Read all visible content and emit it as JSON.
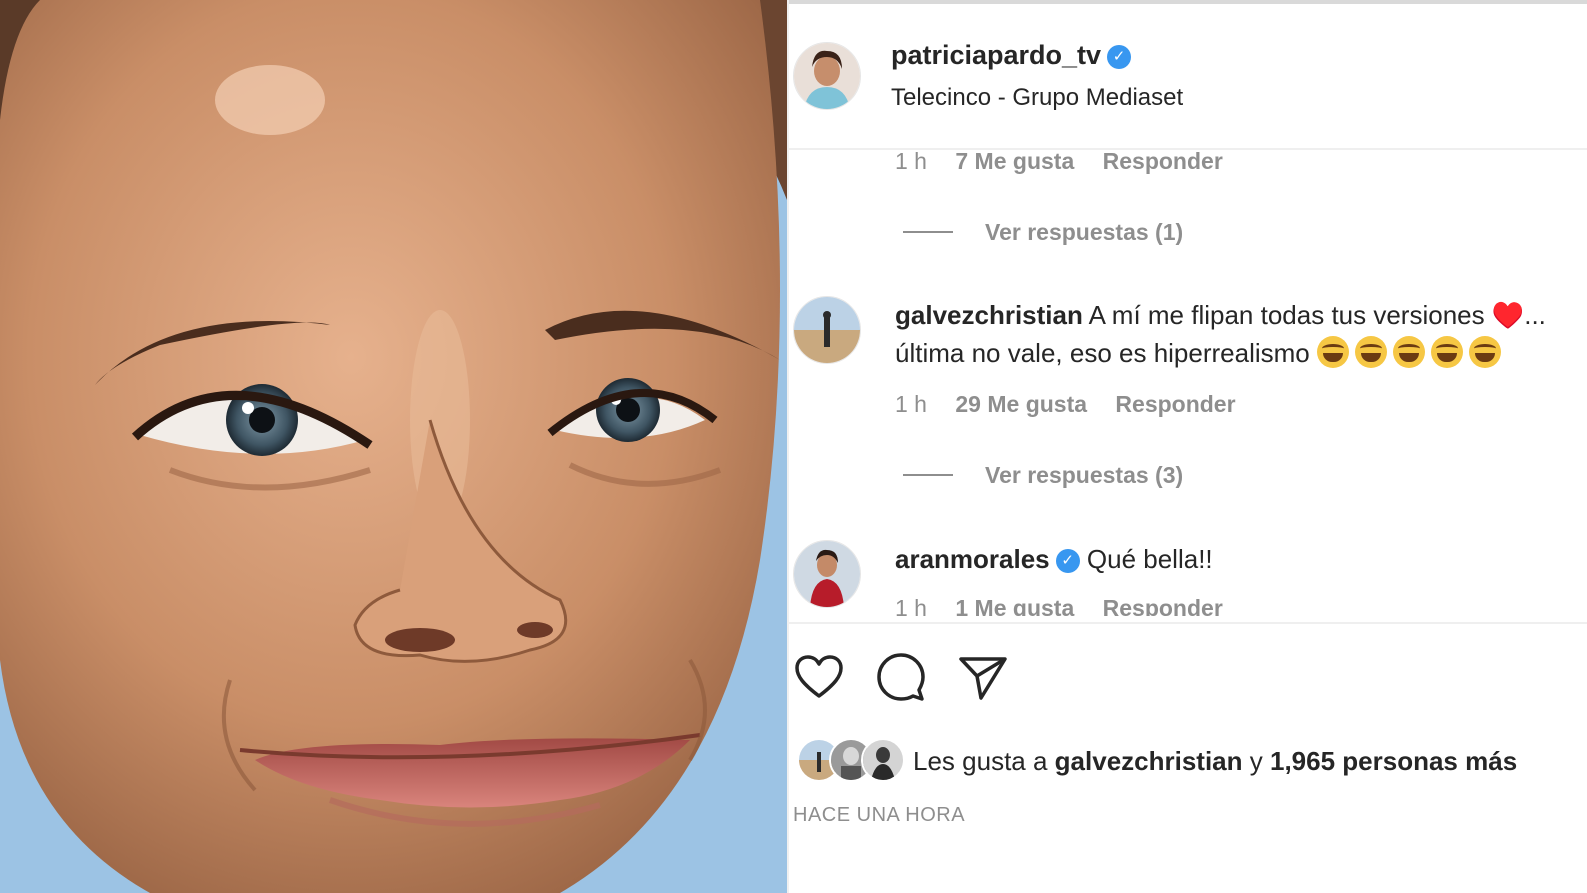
{
  "post": {
    "username": "patriciapardo_tv",
    "location": "Telecinco - Grupo Mediaset",
    "verified": true
  },
  "comments": [
    {
      "time": "1 h",
      "likes": "7 Me gusta",
      "reply": "Responder",
      "view_replies": "Ver respuestas (1)"
    },
    {
      "username": "galvezchristian",
      "text": "A mí me flipan todas tus versiones ♥️...",
      "text_line2": "última no vale, eso es hiperrealismo",
      "emoji_count": 5,
      "time": "1 h",
      "likes": "29 Me gusta",
      "reply": "Responder",
      "view_replies": "Ver respuestas (3)"
    },
    {
      "username": "aranmorales",
      "verified": true,
      "text": "Qué bella!!",
      "time": "1 h",
      "likes": "1 Me gusta",
      "reply": "Responder"
    }
  ],
  "likes": {
    "prefix": "Les gusta a",
    "user": "galvezchristian",
    "conj": "y",
    "others": "1,965 personas más"
  },
  "timestamp": "HACE UNA HORA",
  "colors": {
    "verified": "#3897f0",
    "text": "#262626",
    "muted": "#8e8e8e"
  },
  "icons": [
    "heart-icon",
    "comment-icon",
    "share-icon"
  ]
}
